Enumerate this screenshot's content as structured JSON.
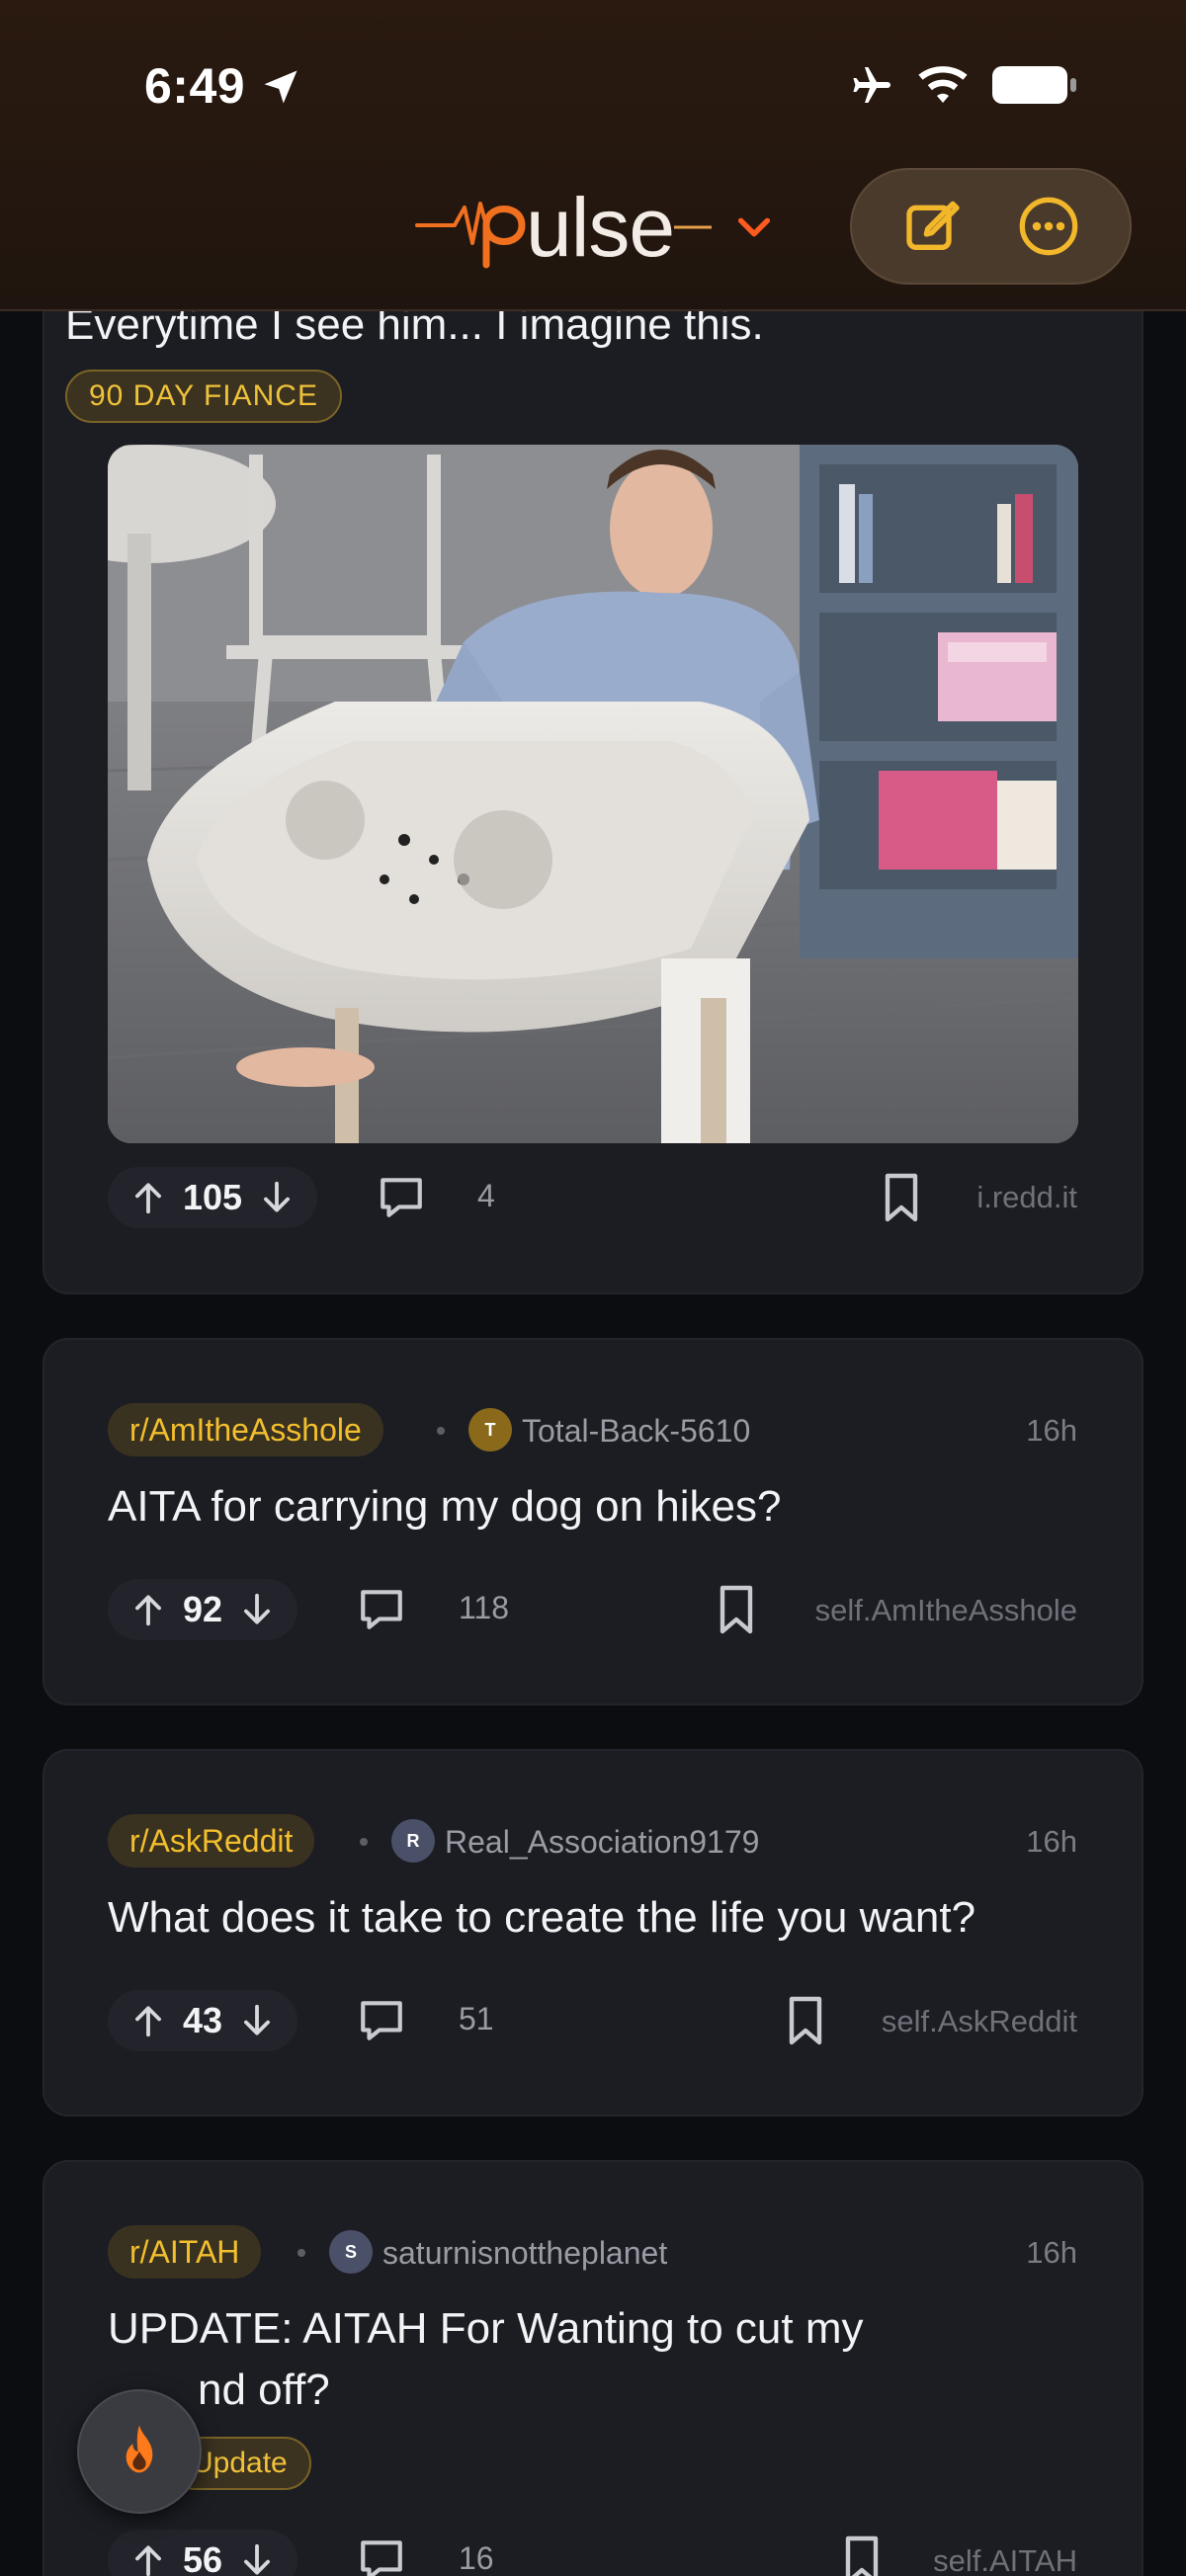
{
  "status_bar": {
    "time": "6:49"
  },
  "header": {
    "logo": "pulse"
  },
  "colors": {
    "accent": "#f0b429",
    "brand_orange": "#ff6a1a",
    "card_bg": "#1c1d23",
    "flair_bg": "#3b3220"
  },
  "posts": [
    {
      "title": "Everytime I see him... I imagine this.",
      "flair": "90 DAY FIANCE",
      "score": "105",
      "comments": "4",
      "domain": "i.redd.it"
    },
    {
      "subreddit": "r/AmItheAsshole",
      "avatar_letter": "T",
      "author": "Total-Back-5610",
      "age": "16h",
      "title": "AITA for carrying my dog on hikes?",
      "score": "92",
      "comments": "118",
      "domain": "self.AmItheAsshole"
    },
    {
      "subreddit": "r/AskReddit",
      "avatar_letter": "R",
      "author": "Real_Association9179",
      "age": "16h",
      "title": "What does it take to create the life you want?",
      "score": "43",
      "comments": "51",
      "domain": "self.AskReddit"
    },
    {
      "subreddit": "r/AITAH",
      "avatar_letter": "S",
      "author": "saturnisnottheplanet",
      "age": "16h",
      "title_line1": "UPDATE: AITAH For Wanting to cut my",
      "title_line2": "nd off?",
      "flair": "Update",
      "score": "56",
      "comments": "16",
      "domain": "self.AITAH"
    }
  ]
}
